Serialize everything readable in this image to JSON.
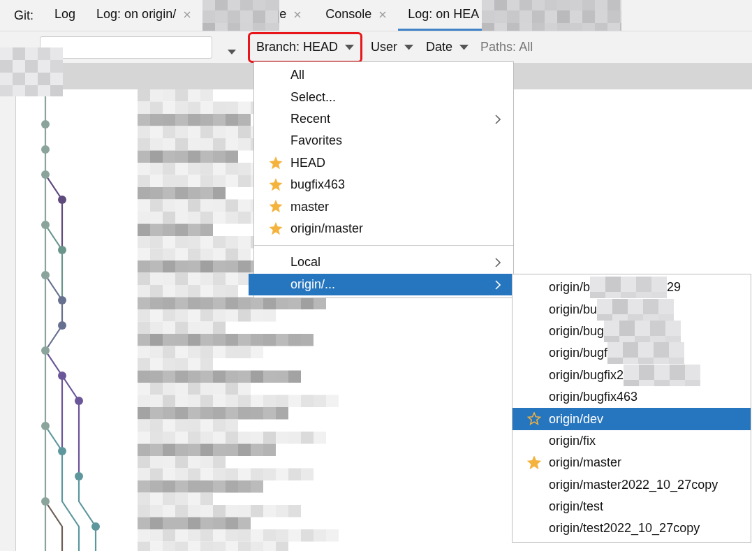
{
  "tool_window": {
    "title": "Git:",
    "tabs": [
      {
        "label": "Log",
        "redacted": false,
        "selected": false,
        "closable": false
      },
      {
        "label": "Log: on origin/",
        "redacted": true,
        "label_end": "e",
        "selected": false,
        "closable": true
      },
      {
        "label": "Console",
        "redacted": false,
        "selected": false,
        "closable": true
      },
      {
        "label": "Log: on HEA",
        "redacted": true,
        "selected": true,
        "closable": false
      }
    ]
  },
  "toolbar": {
    "filters": [
      {
        "label": "Branch: HEAD",
        "highlighted": true
      },
      {
        "label": "User",
        "highlighted": false
      },
      {
        "label": "Date",
        "highlighted": false
      }
    ],
    "paths": "Paths: All"
  },
  "branch_menu": {
    "items": [
      {
        "kind": "item",
        "label": "All",
        "favorite": false,
        "submenu": false,
        "selected": false
      },
      {
        "kind": "item",
        "label": "Select...",
        "favorite": false,
        "submenu": false,
        "selected": false
      },
      {
        "kind": "item",
        "label": "Recent",
        "favorite": false,
        "submenu": true,
        "selected": false
      },
      {
        "kind": "item",
        "label": "Favorites",
        "favorite": false,
        "submenu": false,
        "selected": false
      },
      {
        "kind": "item",
        "label": "HEAD",
        "favorite": true,
        "submenu": false,
        "selected": false
      },
      {
        "kind": "item",
        "label": "bugfix463",
        "favorite": true,
        "submenu": false,
        "selected": false
      },
      {
        "kind": "item",
        "label": "master",
        "favorite": true,
        "submenu": false,
        "selected": false
      },
      {
        "kind": "item",
        "label": "origin/master",
        "favorite": true,
        "submenu": false,
        "selected": false
      },
      {
        "kind": "separator"
      },
      {
        "kind": "item",
        "label": "Local",
        "favorite": false,
        "submenu": true,
        "selected": false
      },
      {
        "kind": "item",
        "label": "origin/...",
        "favorite": false,
        "submenu": true,
        "selected": true
      }
    ]
  },
  "origin_submenu": {
    "items": [
      {
        "label": "origin/b",
        "redacted": true,
        "label_end": "29",
        "favorite": false,
        "selected": false
      },
      {
        "label": "origin/bu",
        "redacted": true,
        "favorite": false,
        "selected": false
      },
      {
        "label": "origin/bug",
        "redacted": true,
        "favorite": false,
        "selected": false
      },
      {
        "label": "origin/bugf",
        "redacted": true,
        "favorite": false,
        "selected": false
      },
      {
        "label": "origin/bugfix2",
        "redacted": true,
        "favorite": false,
        "selected": false
      },
      {
        "label": "origin/bugfix463",
        "redacted": false,
        "favorite": false,
        "selected": false
      },
      {
        "label": "origin/dev",
        "redacted": false,
        "favorite": false,
        "selected": true
      },
      {
        "label": "origin/fix",
        "redacted": false,
        "favorite": false,
        "selected": false
      },
      {
        "label": "origin/master",
        "redacted": false,
        "favorite": true,
        "selected": false
      },
      {
        "label": "origin/master2022_10_27copy",
        "redacted": false,
        "favorite": false,
        "selected": false
      },
      {
        "label": "origin/test",
        "redacted": false,
        "favorite": false,
        "selected": false
      },
      {
        "label": "origin/test2022_10_27copy",
        "redacted": false,
        "favorite": false,
        "selected": false
      }
    ]
  }
}
